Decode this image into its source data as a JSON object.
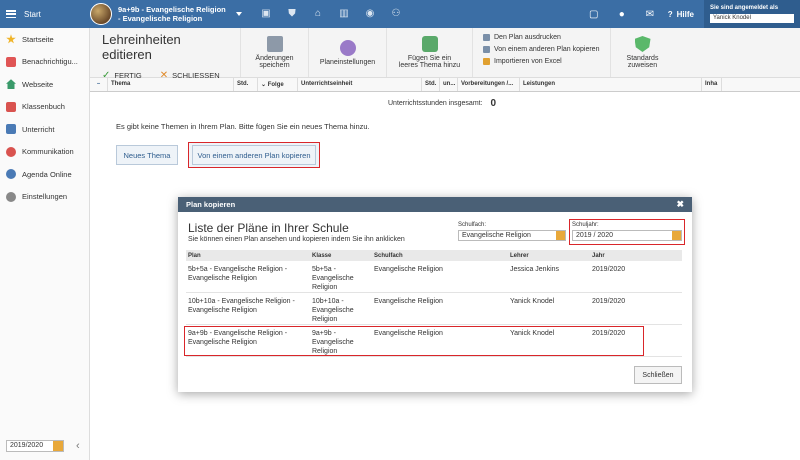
{
  "topbar": {
    "start_label": "Start",
    "class_title_line1": "9a+9b - Evangelische Religion",
    "class_title_line2": "- Evangelische Religion",
    "icons": [
      "briefcase-icon",
      "shield-icon",
      "institution-icon",
      "chart-icon",
      "badge-icon",
      "people-icon"
    ],
    "right_icons": [
      "screen-icon",
      "chat-icon",
      "mail-icon",
      "help-icon"
    ],
    "help_label": "Hilfe",
    "logged_in_label": "Sie sind angemeldet als",
    "user_name": "Yanick Knodel"
  },
  "sidebar": {
    "items": [
      {
        "label": "Startseite",
        "icon": "star-icon",
        "color": "#f0b429"
      },
      {
        "label": "Benachrichtigu...",
        "icon": "bell-icon",
        "color": "#e05555"
      },
      {
        "label": "Webseite",
        "icon": "home-icon",
        "color": "#3a9a6a"
      },
      {
        "label": "Klassenbuch",
        "icon": "book-icon",
        "color": "#d9534f"
      },
      {
        "label": "Unterricht",
        "icon": "folder-icon",
        "color": "#4a7ab5"
      },
      {
        "label": "Kommunikation",
        "icon": "chat-icon",
        "color": "#d9534f"
      },
      {
        "label": "Agenda Online",
        "icon": "check-icon",
        "color": "#4a7ab5"
      },
      {
        "label": "Einstellungen",
        "icon": "gear-icon",
        "color": "#888888"
      }
    ],
    "year": "2019/2020"
  },
  "toolbar": {
    "title": "Lehreinheiten editieren",
    "fertig": "FERTIG",
    "schliessen": "SCHLIESSEN",
    "save_line1": "Änderungen",
    "save_line2": "speichern",
    "plan_settings": "Planeinstellungen",
    "add_theme_line1": "Fügen Sie ein",
    "add_theme_line2": "leeres Thema hinzu",
    "print_plan": "Den Plan ausdrucken",
    "copy_plan": "Von einem anderen Plan kopieren",
    "import_excel": "Importieren von Excel",
    "standards_line1": "Standards",
    "standards_line2": "zuweisen"
  },
  "grid": {
    "columns": [
      "Thema",
      "Std.",
      "Folge",
      "Unterrichtseinheit",
      "Std.",
      "un...",
      "Vorbereitungen /...",
      "Leistungen",
      "Inha"
    ],
    "total_label": "Unterrichtsstunden insgesamt:",
    "total_value": "0",
    "empty_message": "Es gibt keine Themen in Ihrem Plan. Bitte fügen Sie ein neues Thema hinzu.",
    "new_theme_button": "Neues Thema",
    "copy_plan_button": "Von einem anderen Plan kopieren"
  },
  "dialog": {
    "header": "Plan kopieren",
    "title": "Liste der Pläne in Ihrer Schule",
    "subtitle": "Sie können einen Plan ansehen und kopieren indem Sie ihn anklicken",
    "subject_label": "Schulfach:",
    "subject_value": "Evangelische Religion",
    "year_label": "Schuljahr:",
    "year_value": "2019 / 2020",
    "columns": [
      "Plan",
      "Klasse",
      "Schulfach",
      "Lehrer",
      "Jahr"
    ],
    "rows": [
      {
        "plan1": "5b+5a - Evangelische Religion -",
        "plan2": "Evangelische Religion",
        "klasse1": "5b+5a -",
        "klasse2": "Evangelische",
        "klasse3": "Religion",
        "fach": "Evangelische Religion",
        "lehrer": "Jessica Jenkins",
        "jahr": "2019/2020"
      },
      {
        "plan1": "10b+10a - Evangelische Religion -",
        "plan2": "Evangelische Religion",
        "klasse1": "10b+10a -",
        "klasse2": "Evangelische",
        "klasse3": "Religion",
        "fach": "Evangelische Religion",
        "lehrer": "Yanick Knodel",
        "jahr": "2019/2020"
      },
      {
        "plan1": "9a+9b - Evangelische Religion -",
        "plan2": "Evangelische Religion",
        "klasse1": "9a+9b -",
        "klasse2": "Evangelische",
        "klasse3": "Religion",
        "fach": "Evangelische Religion",
        "lehrer": "Yanick Knodel",
        "jahr": "2019/2020"
      }
    ],
    "close_button": "Schließen"
  },
  "colors": {
    "topbar": "#3b6ea5",
    "dialog_header": "#4a6076",
    "highlight": "#d9262a",
    "spinner": "#e8a83a"
  }
}
